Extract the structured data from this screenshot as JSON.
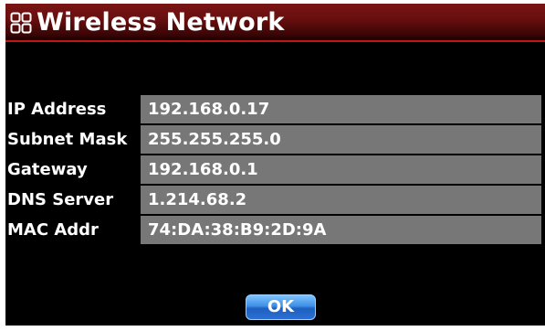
{
  "window": {
    "title": "Wireless Network",
    "title_icon": "grid-icon",
    "title_bar_color": "#6a0f0f",
    "accent_line_color": "#c01818",
    "background_color": "#000000"
  },
  "network_info": {
    "rows": [
      {
        "label": "IP Address",
        "value": "192.168.0.17"
      },
      {
        "label": "Subnet Mask",
        "value": "255.255.255.0"
      },
      {
        "label": "Gateway",
        "value": "192.168.0.1"
      },
      {
        "label": "DNS Server",
        "value": "1.214.68.2"
      },
      {
        "label": "MAC Addr",
        "value": "74:DA:38:B9:2D:9A"
      }
    ],
    "value_field_color": "#777777"
  },
  "actions": {
    "ok_label": "OK",
    "ok_color": "#3e8fe6"
  }
}
